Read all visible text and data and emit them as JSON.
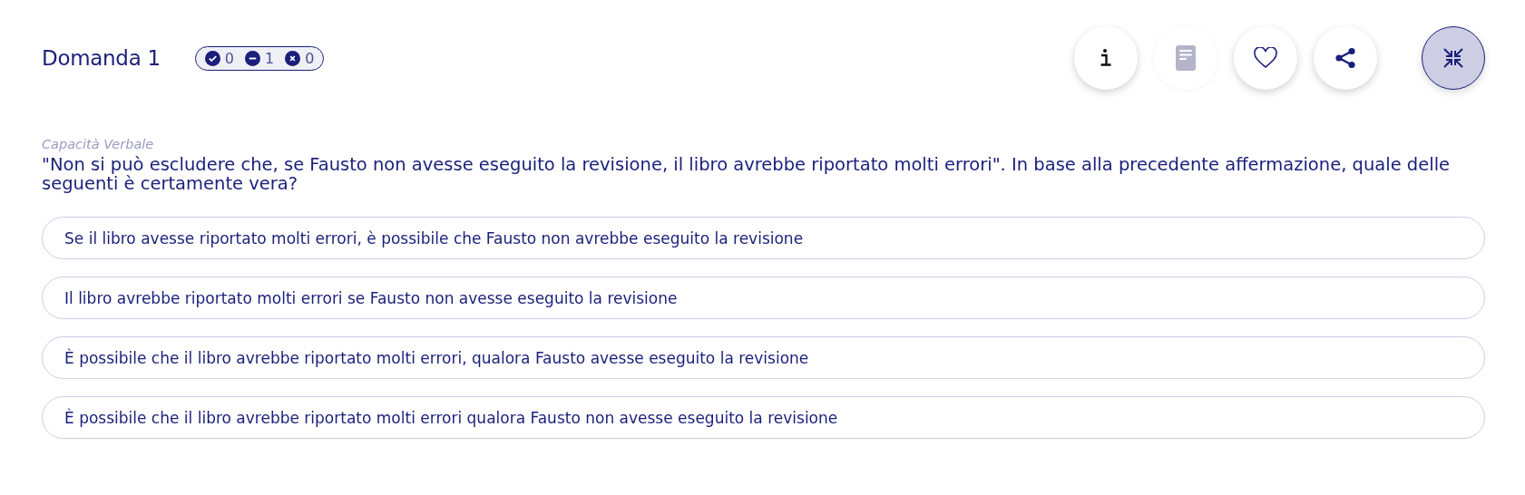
{
  "header": {
    "title": "Domanda 1",
    "stats": [
      {
        "kind": "correct",
        "count": "0"
      },
      {
        "kind": "skipped",
        "count": "1"
      },
      {
        "kind": "wrong",
        "count": "0"
      }
    ]
  },
  "actions": [
    {
      "kind": "info",
      "disabled": false
    },
    {
      "kind": "notes",
      "disabled": true
    },
    {
      "kind": "favorite",
      "disabled": false
    },
    {
      "kind": "share",
      "disabled": false
    },
    {
      "kind": "collapse",
      "disabled": false
    }
  ],
  "question": {
    "category": "Capacità Verbale",
    "text": "\"Non si può escludere che, se Fausto non avesse eseguito la revisione, il libro avrebbe riportato molti errori\". In base alla precedente affermazione, quale delle seguenti è certamente vera?"
  },
  "answers": [
    {
      "text": "Se il libro avesse riportato molti errori, è possibile che Fausto non avrebbe eseguito la revisione",
      "selected": false
    },
    {
      "text": "Il libro avrebbe riportato molti errori se Fausto non avesse eseguito la revisione",
      "selected": false
    },
    {
      "text": "È possibile che il libro avrebbe riportato molti errori, qualora Fausto avesse eseguito la revisione",
      "selected": false
    },
    {
      "text": "È possibile che il libro avrebbe riportato molti errori qualora Fausto non avesse eseguito la revisione",
      "selected": false
    }
  ]
}
